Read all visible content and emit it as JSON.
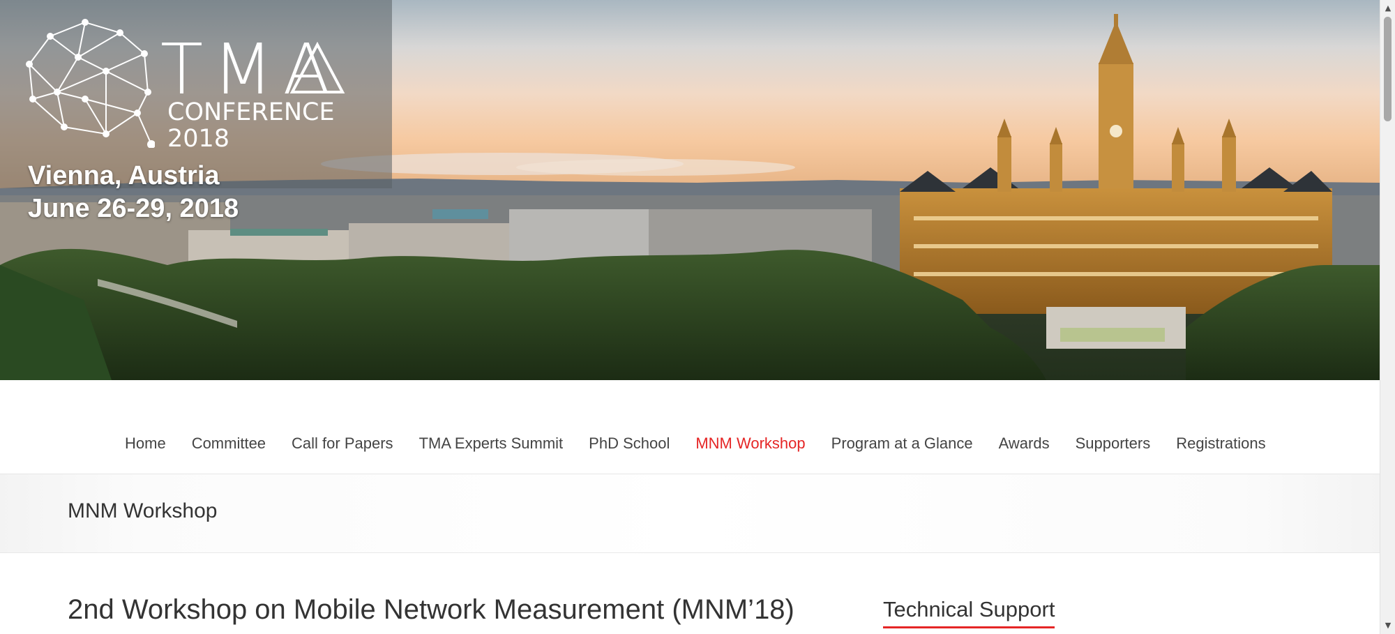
{
  "hero": {
    "logo": {
      "tma": "TMA",
      "conference": "CONFERENCE",
      "year": "2018"
    },
    "location": "Vienna, Austria",
    "dates": "June 26-29, 2018"
  },
  "nav": {
    "items": [
      {
        "label": "Home"
      },
      {
        "label": "Committee"
      },
      {
        "label": "Call for Papers"
      },
      {
        "label": "TMA Experts Summit"
      },
      {
        "label": "PhD School"
      },
      {
        "label": "MNM Workshop",
        "active": true
      },
      {
        "label": "Program at a Glance"
      },
      {
        "label": "Awards"
      },
      {
        "label": "Supporters"
      },
      {
        "label": "Registrations"
      }
    ]
  },
  "page": {
    "title": "MNM Workshop",
    "article_title": "2nd Workshop on Mobile Network Measurement (MNM’18)"
  },
  "sidebar": {
    "widget_title": "Technical Support"
  },
  "colors": {
    "accent": "#e52525",
    "text": "#333333",
    "nav_text": "#444444"
  },
  "scrollbar": {
    "up_icon": "triangle-up-icon",
    "down_icon": "triangle-down-icon"
  }
}
